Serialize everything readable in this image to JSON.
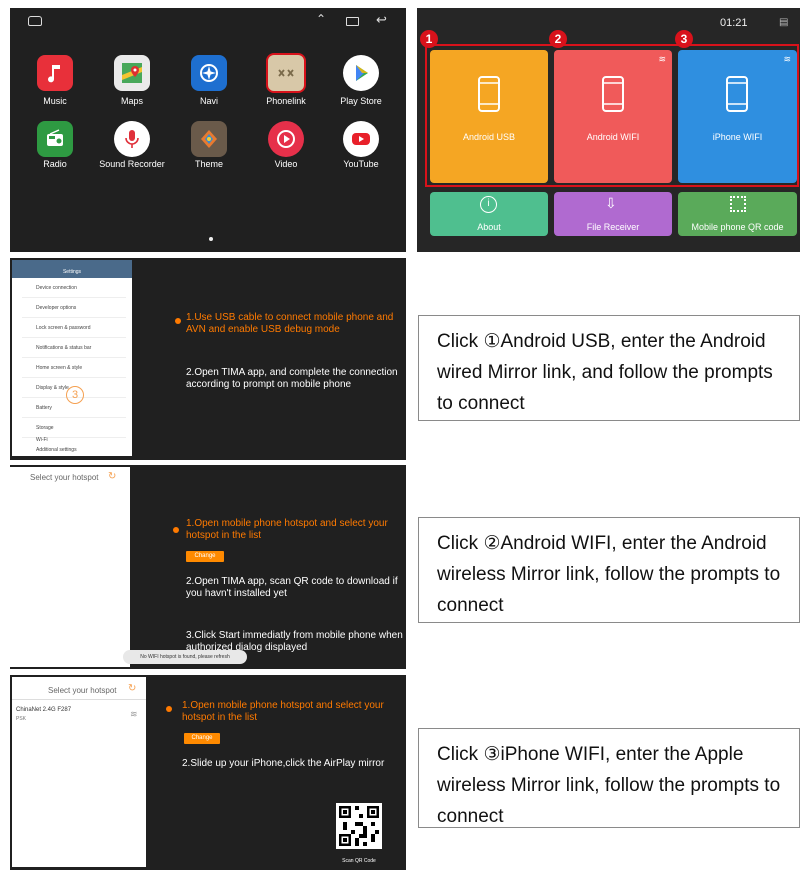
{
  "launcher": {
    "apps_row1": [
      {
        "label": "Music",
        "icon": "music-note",
        "color": "#e8303a"
      },
      {
        "label": "Maps",
        "icon": "maps",
        "color": "#3c9a4a"
      },
      {
        "label": "Navi",
        "icon": "compass",
        "color": "#1e6fd0"
      },
      {
        "label": "Phonelink",
        "icon": "phonelink",
        "color": "#c8b89a"
      },
      {
        "label": "Play Store",
        "icon": "play",
        "color": "#ffffff"
      }
    ],
    "apps_row2": [
      {
        "label": "Radio",
        "icon": "radio",
        "color": "#2e9a42"
      },
      {
        "label": "Sound Recorder",
        "icon": "microphone",
        "color": "#e0303a"
      },
      {
        "label": "Theme",
        "icon": "theme",
        "color": "#8a6a4a"
      },
      {
        "label": "Video",
        "icon": "play-circle",
        "color": "#e6304a"
      },
      {
        "label": "YouTube",
        "icon": "youtube",
        "color": "#e8202a"
      }
    ]
  },
  "phonelink": {
    "time": "01:21",
    "tiles": [
      {
        "num": "1",
        "label": "Android USB",
        "color": "#f5a623"
      },
      {
        "num": "2",
        "label": "Android WIFI",
        "color": "#f05a5a"
      },
      {
        "num": "3",
        "label": "iPhone WIFI",
        "color": "#2f8fe0"
      }
    ],
    "bottom": [
      {
        "label": "About",
        "color": "#4fbf8f"
      },
      {
        "label": "File Receiver",
        "color": "#b06ad0"
      },
      {
        "label": "Mobile phone QR code",
        "color": "#5aaa5a"
      }
    ]
  },
  "usb": {
    "settings_title": "Settings",
    "settings_items": [
      "Device connection",
      "Developer options",
      "Lock screen & password",
      "Notifications & status bar",
      "Home screen & style",
      "Display & style",
      "Battery",
      "Storage",
      "Wi-Fi",
      "Additional settings"
    ],
    "marker": "3",
    "step1": "1.Use USB cable to connect mobile phone and AVN and enable USB debug mode",
    "step2": "2.Open TIMA app, and complete the connection according to prompt on mobile phone"
  },
  "android_wifi": {
    "hotspot_title": "Select your hotspot",
    "step1": "1.Open mobile phone hotspot and select your hotspot in the list",
    "change": "Change",
    "step2": "2.Open TIMA app, scan QR code to download if you havn't installed yet",
    "step3": "3.Click Start immediatly from mobile phone when authorized dialog displayed",
    "toast": "No WIFI hotspot is found, please refresh"
  },
  "iphone_wifi": {
    "hotspot_title": "Select your hotspot",
    "network_name": "ChinaNet 2.4G F287",
    "network_sub": "PSK",
    "step1": "1.Open mobile phone hotspot and select your hotspot in the list",
    "change": "Change",
    "step2": "2.Slide up your iPhone,click the AirPlay mirror",
    "qr_label": "Scan QR Code"
  },
  "captions": [
    "Click ①Android USB, enter the Android wired Mirror link, and follow the prompts to connect",
    "Click ②Android WIFI, enter the Android wireless Mirror link, follow the prompts to connect",
    "Click ③iPhone WIFI, enter the Apple wireless Mirror link, follow the prompts to connect"
  ]
}
